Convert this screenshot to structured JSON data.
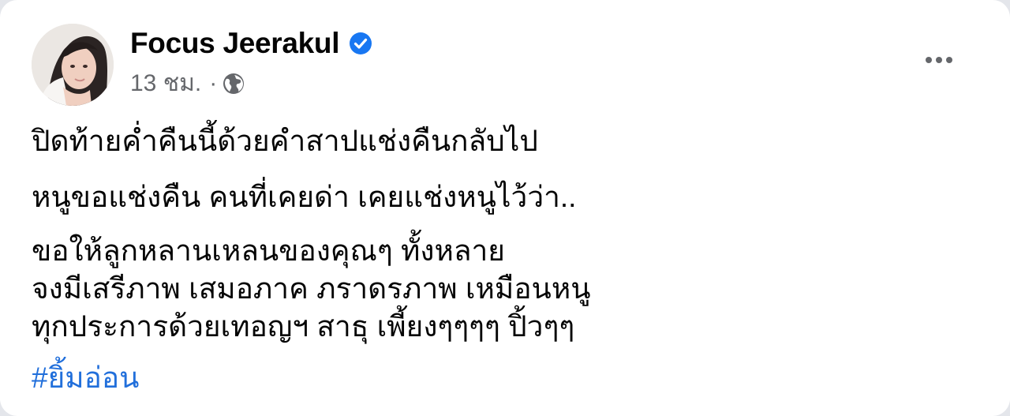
{
  "post": {
    "author": {
      "name": "Focus Jeerakul",
      "verified": true,
      "avatar_icon": "profile-photo"
    },
    "meta": {
      "time": "13 ชม.",
      "separator": "·",
      "audience_icon": "globe-icon"
    },
    "menu_icon": "more-options-icon",
    "lines": [
      "ปิดท้ายค่ำคืนนี้ด้วยคำสาปแช่งคืนกลับไป",
      "หนูขอแช่งคืน คนที่เคยด่า เคยแช่งหนูไว้ว่า..",
      "ขอให้ลูกหลานเหลนของคุณๆ ทั้งหลาย",
      "จงมีเสรีภาพ เสมอภาค ภราดรภาพ เหมือนหนู",
      "ทุกประการด้วยเทอญฯ สาธุ เพี้ยงๆๆๆๆ ปิ้วๆๆ"
    ],
    "hashtag": "#ยิ้มอ่อน"
  },
  "colors": {
    "text": "#050505",
    "secondary": "#65676b",
    "verified": "#1877f2",
    "hashtag": "#216fdb"
  }
}
